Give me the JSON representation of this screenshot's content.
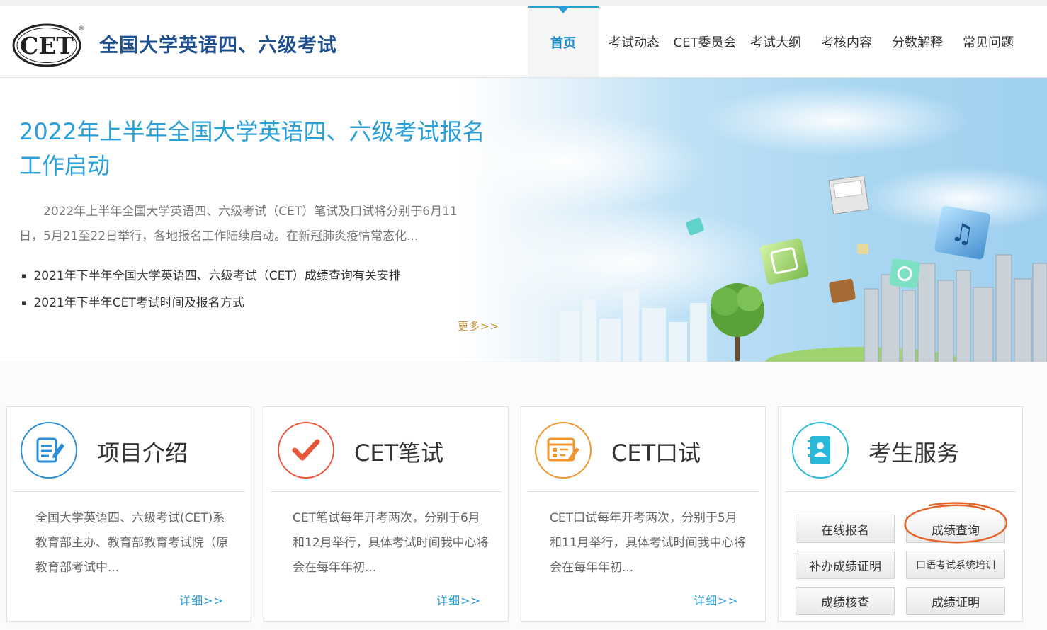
{
  "header": {
    "logo_text": "CET",
    "site_title": "全国大学英语四、六级考试"
  },
  "nav": [
    {
      "label": "首页",
      "active": true
    },
    {
      "label": "考试动态"
    },
    {
      "label": "CET委员会"
    },
    {
      "label": "考试大纲"
    },
    {
      "label": "考核内容"
    },
    {
      "label": "分数解释"
    },
    {
      "label": "常见问题"
    }
  ],
  "banner": {
    "headline": "2022年上半年全国大学英语四、六级考试报名工作启动",
    "summary": "2022年上半年全国大学英语四、六级考试（CET）笔试及口试将分别于6月11日，5月21至22日举行，各地报名工作陆续启动。在新冠肺炎疫情常态化...",
    "news": [
      "2021年下半年全国大学英语四、六级考试（CET）成绩查询有关安排",
      "2021年下半年CET考试时间及报名方式"
    ],
    "more": "更多>>"
  },
  "cards": [
    {
      "title": "项目介绍",
      "icon": "document-edit-icon",
      "color": "#2a8fd6",
      "desc": "全国大学英语四、六级考试(CET)系教育部主办、教育部教育考试院（原教育部考试中...",
      "detail": "详细>>"
    },
    {
      "title": "CET笔试",
      "icon": "checkmark-icon",
      "color": "#e8573a",
      "desc": "CET笔试每年开考两次，分别于6月和12月举行，具体考试时间我中心将会在每年年初...",
      "detail": "详细>>"
    },
    {
      "title": "CET口试",
      "icon": "form-pencil-icon",
      "color": "#f0962f",
      "desc": "CET口试每年开考两次，分别于5月和11月举行，具体考试时间我中心将会在每年年初...",
      "detail": "详细>>"
    },
    {
      "title": "考生服务",
      "icon": "contact-book-icon",
      "color": "#29b8d8"
    }
  ],
  "services": [
    "在线报名",
    "成绩查询",
    "补办成绩证明",
    "口语考试系统培训",
    "成绩核查",
    "成绩证明"
  ],
  "colors": {
    "accent": "#2a9fd8",
    "title_blue": "#1f4f8f",
    "more_gold": "#c9923a",
    "annotation": "#e2662a"
  }
}
